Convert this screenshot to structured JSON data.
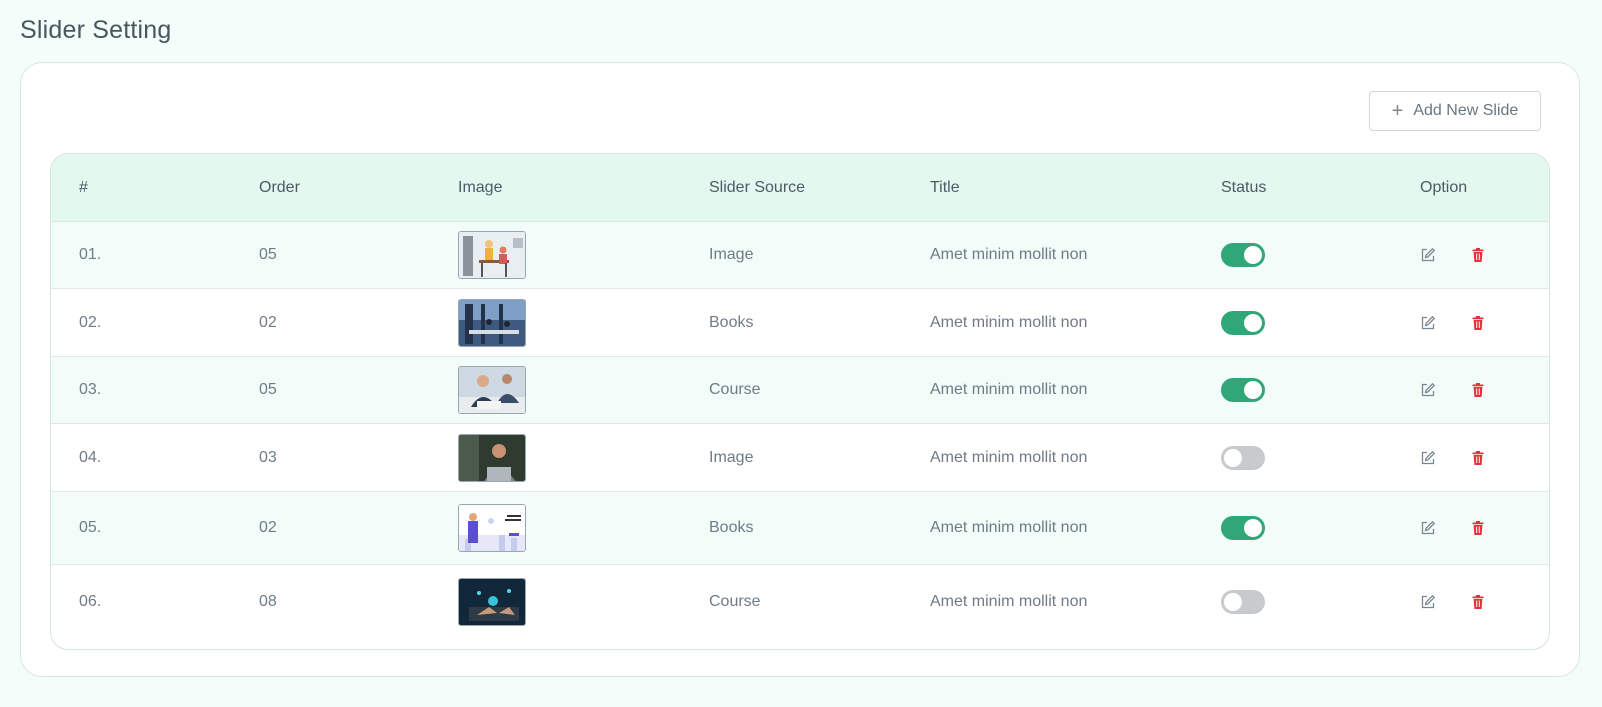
{
  "page": {
    "title": "Slider Setting"
  },
  "toolbar": {
    "add_label": "Add New Slide",
    "add_icon": "plus-icon"
  },
  "table": {
    "headers": [
      "#",
      "Order",
      "Image",
      "Slider Source",
      "Title",
      "Status",
      "Option"
    ],
    "rows": [
      {
        "num": "01.",
        "order": "05",
        "image": "office-team-illustration",
        "source": "Image",
        "title": "Amet minim mollit non",
        "status": "on"
      },
      {
        "num": "02.",
        "order": "02",
        "image": "modern-office-photo",
        "source": "Books",
        "title": "Amet minim mollit non",
        "status": "on"
      },
      {
        "num": "03.",
        "order": "05",
        "image": "business-meeting-photo",
        "source": "Course",
        "title": "Amet minim mollit non",
        "status": "on"
      },
      {
        "num": "04.",
        "order": "03",
        "image": "man-laptop-photo",
        "source": "Image",
        "title": "Amet minim mollit non",
        "status": "off"
      },
      {
        "num": "05.",
        "order": "02",
        "image": "landing-page-illustration",
        "source": "Books",
        "title": "Amet minim mollit non",
        "status": "on"
      },
      {
        "num": "06.",
        "order": "08",
        "image": "laptop-tech-photo",
        "source": "Course",
        "title": "Amet minim mollit non",
        "status": "off"
      }
    ]
  },
  "colors": {
    "toggle_on": "#2fa779",
    "toggle_off": "#c8cbcd",
    "delete": "#e0333d",
    "header_bg": "#e3f8ef",
    "page_bg": "#f3fdf9"
  }
}
